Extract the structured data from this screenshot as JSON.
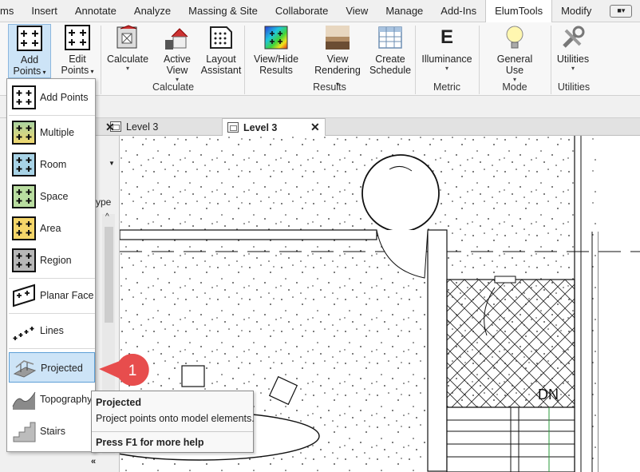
{
  "menubar": {
    "tabs": [
      "ms",
      "Insert",
      "Annotate",
      "Analyze",
      "Massing & Site",
      "Collaborate",
      "View",
      "Manage",
      "Add-Ins",
      "ElumTools",
      "Modify"
    ],
    "active_tab": "ElumTools"
  },
  "ribbon": {
    "add_points": {
      "line1": "Add",
      "line2": "Points"
    },
    "edit_points": {
      "line1": "Edit",
      "line2": "Points"
    },
    "calculate": {
      "line1": "Calculate"
    },
    "active_view": {
      "line1": "Active",
      "line2": "View"
    },
    "layout_assistant": {
      "line1": "Layout",
      "line2": "Assistant"
    },
    "view_hide_results": {
      "line1": "View/Hide",
      "line2": "Results"
    },
    "view_rendering": {
      "line1": "View",
      "line2": "Rendering"
    },
    "create_schedule": {
      "line1": "Create",
      "line2": "Schedule"
    },
    "illuminance": {
      "line1": "Illuminance",
      "icon_letter": "E"
    },
    "general_use": {
      "line1": "General Use"
    },
    "utilities": {
      "line1": "Utilities"
    },
    "groups": {
      "calculate": "Calculate",
      "results": "Results",
      "metric": "Metric",
      "mode": "Mode",
      "utilities": "Utilities"
    }
  },
  "viewtabs": {
    "tab1": "Level 3",
    "tab2": "Level 3"
  },
  "leftpanel": {
    "partial_text": "ype"
  },
  "dropdown": {
    "items": [
      {
        "label": "Add  Points"
      },
      {
        "label": "Multiple"
      },
      {
        "label": "Room"
      },
      {
        "label": "Space"
      },
      {
        "label": "Area"
      },
      {
        "label": "Region"
      },
      {
        "label": "Planar Face"
      },
      {
        "label": "Lines"
      },
      {
        "label": "Projected"
      },
      {
        "label": "Topography"
      },
      {
        "label": "Stairs"
      }
    ]
  },
  "callout": {
    "number": "1"
  },
  "tooltip": {
    "title": "Projected",
    "description": "Project points onto model elements.",
    "help": "Press F1 for more help"
  },
  "canvas": {
    "stair_label": "DN"
  },
  "colors": {
    "accent": "#cde4f7",
    "accent_border": "#5d9fd6",
    "callout": "#e74d4d"
  }
}
